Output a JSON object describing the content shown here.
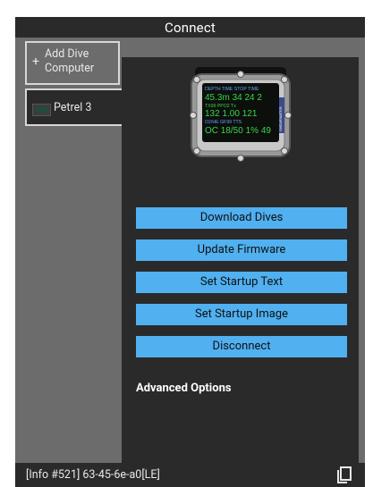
{
  "header": {
    "title": "Connect"
  },
  "sidebar": {
    "add_button_plus": "+",
    "add_button_label_line1": "Add Dive",
    "add_button_label_line2": "Computer",
    "devices": [
      {
        "name": "Petrel 3"
      }
    ]
  },
  "device_screen": {
    "row1_labels": "DEPTH TIME STOP TIME",
    "row1_values": "45.3m 34  24  2",
    "row2_labels": "TX99   PPO2  Tx",
    "row2_values": "132  1.00  121",
    "row3_labels": "O2/HE  GF99  TTS",
    "row3_values": "OC 18/50  1% 49",
    "brand": "SHEARWATER"
  },
  "actions": {
    "download": "Download Dives",
    "firmware": "Update Firmware",
    "startup_text": "Set Startup Text",
    "startup_image": "Set Startup Image",
    "disconnect": "Disconnect"
  },
  "advanced_label": "Advanced Options",
  "status": {
    "info": "[Info #521] 63-45-6e-a0[LE]"
  },
  "colors": {
    "button_bg": "#50b0f0",
    "panel_dark": "#2a2a2a",
    "panel_gray": "#6c6c6c",
    "sidebar_border": "#d7d7d7"
  },
  "icons": {
    "add": "plus-icon",
    "device_thumb": "dive-computer-thumbnail-icon",
    "copy": "copy-icon"
  }
}
